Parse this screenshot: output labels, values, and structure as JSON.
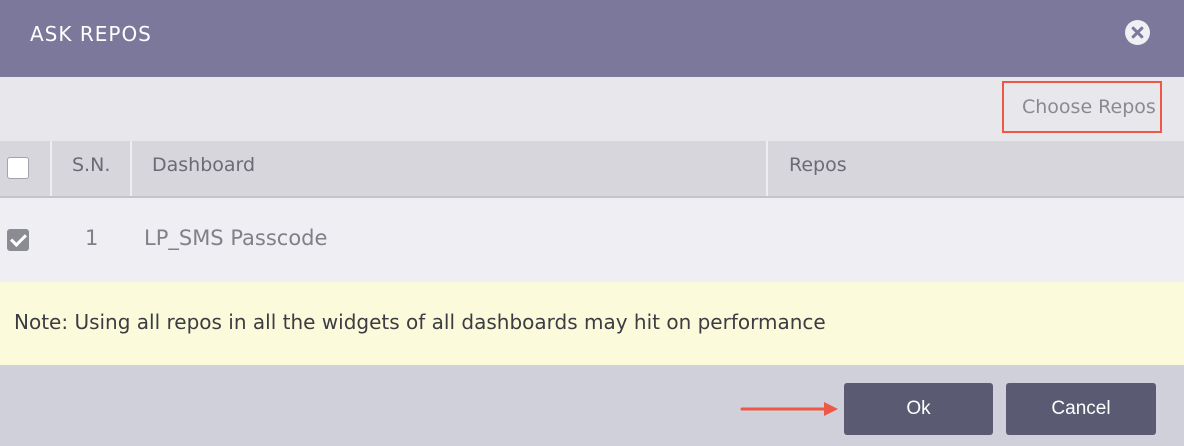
{
  "dialog": {
    "title": "ASK REPOS",
    "close_icon": "close-circle-icon"
  },
  "toolbar": {
    "choose_repos_label": "Choose Repos"
  },
  "table": {
    "columns": [
      "S.N.",
      "Dashboard",
      "Repos"
    ],
    "select_all_checked": false,
    "rows": [
      {
        "checked": true,
        "sn": "1",
        "dashboard": "LP_SMS Passcode",
        "repos": ""
      }
    ]
  },
  "note": {
    "text": "Note: Using all repos in all the widgets of all dashboards may hit on performance"
  },
  "footer": {
    "ok_label": "Ok",
    "cancel_label": "Cancel"
  },
  "colors": {
    "header": "#7b789b",
    "highlight": "#ee5846",
    "button": "#5a5a72",
    "note_bg": "#fbfbdc"
  }
}
